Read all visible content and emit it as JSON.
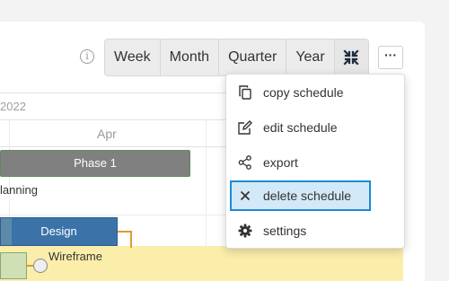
{
  "toolbar": {
    "info_icon": "info-icon",
    "views": [
      "Week",
      "Month",
      "Quarter",
      "Year"
    ],
    "collapse_icon": "collapse-icon",
    "more_label": "···"
  },
  "timeline": {
    "year_label": "2022",
    "month_label": "Apr",
    "rows": {
      "phase_label": "Phase 1",
      "planning_label": "lanning",
      "design_label": "Design",
      "wireframe_label": "Wireframe"
    },
    "colors": {
      "phase": "#808080",
      "design": "#3b73a8",
      "connector": "#e09a2d",
      "highlight": "#fbeeaa"
    }
  },
  "menu": {
    "items": [
      {
        "label": "copy schedule",
        "icon": "copy-icon"
      },
      {
        "label": "edit schedule",
        "icon": "edit-icon"
      },
      {
        "label": "export",
        "icon": "share-icon"
      },
      {
        "label": "delete schedule",
        "icon": "close-icon",
        "active": true
      },
      {
        "label": "settings",
        "icon": "gear-icon"
      }
    ],
    "active_color": "#1a8bd6"
  }
}
